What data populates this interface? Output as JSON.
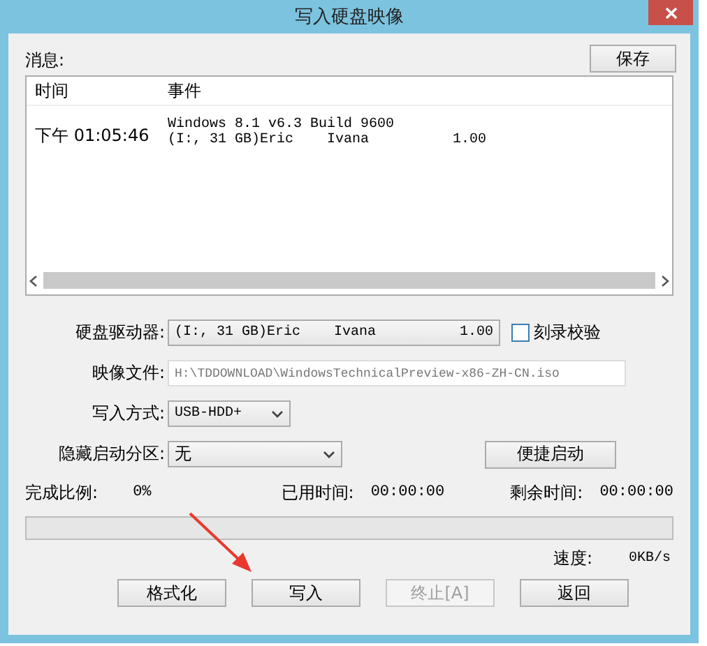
{
  "window": {
    "title": "写入硬盘映像"
  },
  "messages": {
    "label": "消息:",
    "save_button": "保存",
    "columns": [
      "时间",
      "事件"
    ],
    "rows": [
      {
        "time": "下午 01:05:46",
        "event": [
          "Windows 8.1 v6.3 Build 9600",
          "(I:, 31 GB)Eric    Ivana          1.00"
        ]
      }
    ]
  },
  "fields": [
    {
      "kind": "select",
      "label": "硬盘驱动器:",
      "value": "(I:, 31 GB)Eric    Ivana          1.00",
      "checkbox": {
        "label": "刻录校验",
        "checked": false
      }
    },
    {
      "kind": "input",
      "label": "映像文件:",
      "value": "H:\\TDDOWNLOAD\\WindowsTechnicalPreview-x86-ZH-CN.iso",
      "disabled": true
    },
    {
      "kind": "select",
      "label": "写入方式:",
      "value": "USB-HDD+"
    },
    {
      "kind": "select",
      "label": "隐藏启动分区:",
      "value": "无",
      "button": "便捷启动"
    }
  ],
  "progress": {
    "stats": [
      {
        "label": "完成比例:",
        "value": "0%"
      },
      {
        "label": "已用时间:",
        "value": "00:00:00"
      },
      {
        "label": "剩余时间:",
        "value": "00:00:00"
      }
    ],
    "level": 0,
    "speed_label": "速度:",
    "speed_value": "0KB/s"
  },
  "buttons": [
    {
      "label": "格式化",
      "disabled": false
    },
    {
      "label": "写入",
      "disabled": false
    },
    {
      "label": "终止[A]",
      "disabled": true
    },
    {
      "label": "返回",
      "disabled": false
    }
  ]
}
